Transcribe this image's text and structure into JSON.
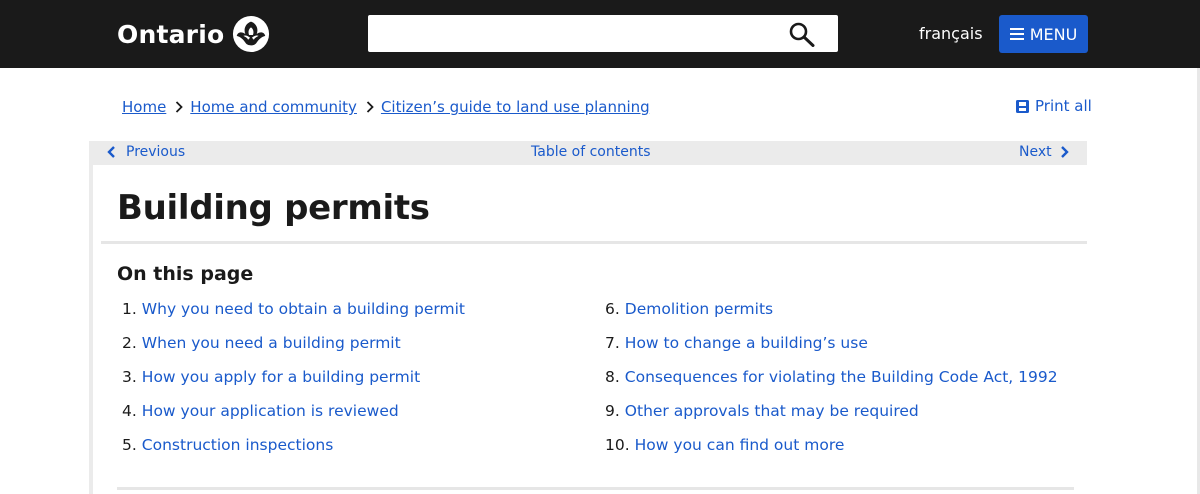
{
  "header": {
    "logo_text": "Ontario",
    "search": {
      "value": "",
      "placeholder": ""
    },
    "language_link": "français",
    "menu_label": "MENU"
  },
  "breadcrumb": [
    "Home",
    "Home and community",
    "Citizen’s guide to land use planning"
  ],
  "print_all": "Print all",
  "pager": {
    "previous": "Previous",
    "table_of_contents": "Table of contents",
    "next": "Next"
  },
  "page": {
    "title": "Building permits",
    "on_this_page": "On this page",
    "toc_left": [
      {
        "num": "1.",
        "label": "Why you need to obtain a building permit"
      },
      {
        "num": "2.",
        "label": "When you need a building permit"
      },
      {
        "num": "3.",
        "label": "How you apply for a building permit"
      },
      {
        "num": "4.",
        "label": "How your application is reviewed"
      },
      {
        "num": "5.",
        "label": "Construction inspections"
      }
    ],
    "toc_right": [
      {
        "num": "6.",
        "label": "Demolition permits"
      },
      {
        "num": "7.",
        "label": "How to change a building’s use"
      },
      {
        "num": "8.",
        "label": "Consequences for violating the Building Code Act, 1992"
      },
      {
        "num": "9.",
        "label": "Other approvals that may be required"
      },
      {
        "num": "10.",
        "label": "How you can find out more"
      }
    ]
  },
  "colors": {
    "header_bg": "#1a1a1a",
    "link": "#1a5acb",
    "menu_button": "#1a5acb",
    "pager_bg": "#ebebeb"
  },
  "icons": [
    "ontario-trillium-logo-icon",
    "search-icon",
    "menu-icon",
    "chevron-right-icon",
    "print-icon",
    "chevron-left-icon"
  ]
}
